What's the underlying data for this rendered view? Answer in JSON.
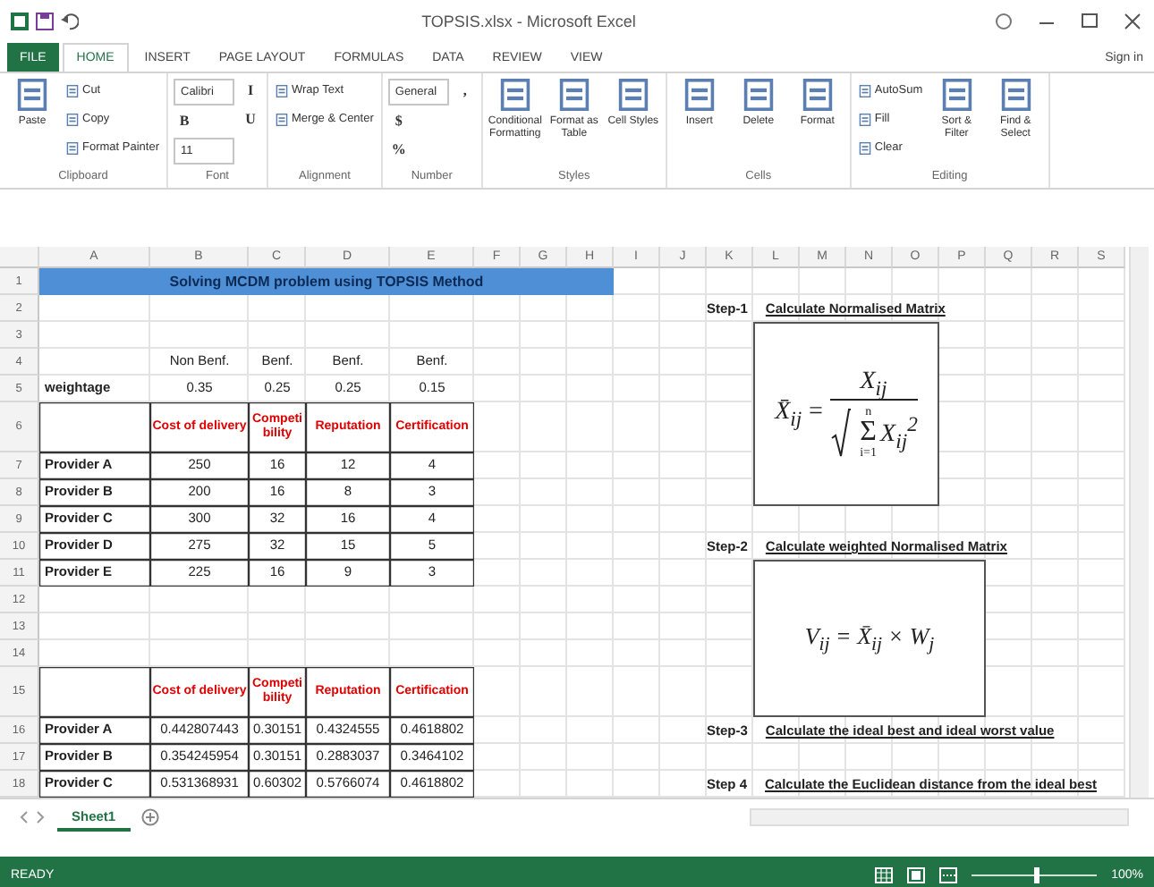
{
  "window": {
    "title": "TOPSIS.xlsx - Microsoft Excel"
  },
  "ribbon_tabs": [
    {
      "label": "FILE",
      "kind": "file",
      "selected": false
    },
    {
      "label": "HOME",
      "kind": "tab",
      "selected": true
    },
    {
      "label": "INSERT",
      "kind": "tab",
      "selected": false
    },
    {
      "label": "PAGE LAYOUT",
      "kind": "tab",
      "selected": false
    },
    {
      "label": "FORMULAS",
      "kind": "tab",
      "selected": false
    },
    {
      "label": "DATA",
      "kind": "tab",
      "selected": false
    },
    {
      "label": "REVIEW",
      "kind": "tab",
      "selected": false
    },
    {
      "label": "VIEW",
      "kind": "tab",
      "selected": false
    }
  ],
  "sign_in": "Sign in",
  "ribbon_groups": [
    {
      "name": "Clipboard",
      "controls": [
        {
          "kind": "large",
          "label": "Paste"
        },
        {
          "kind": "small",
          "label": "Cut"
        },
        {
          "kind": "small",
          "label": "Copy"
        },
        {
          "kind": "small",
          "label": "Format Painter"
        }
      ]
    },
    {
      "name": "Font",
      "controls": [
        {
          "kind": "combo",
          "label": "Calibri"
        },
        {
          "kind": "glyph",
          "label": "B"
        },
        {
          "kind": "combo",
          "label": "11"
        },
        {
          "kind": "glyph",
          "label": "I"
        },
        {
          "kind": "glyph",
          "label": "U"
        }
      ]
    },
    {
      "name": "Alignment",
      "controls": [
        {
          "kind": "small",
          "label": "Wrap Text"
        },
        {
          "kind": "small",
          "label": "Merge & Center"
        }
      ]
    },
    {
      "name": "Number",
      "controls": [
        {
          "kind": "combo",
          "label": "General"
        },
        {
          "kind": "glyph",
          "label": "$"
        },
        {
          "kind": "glyph",
          "label": "%"
        },
        {
          "kind": "glyph",
          "label": ","
        }
      ]
    },
    {
      "name": "Styles",
      "controls": [
        {
          "kind": "large",
          "label": "Conditional Formatting"
        },
        {
          "kind": "large",
          "label": "Format as Table"
        },
        {
          "kind": "large",
          "label": "Cell Styles"
        }
      ]
    },
    {
      "name": "Cells",
      "controls": [
        {
          "kind": "large",
          "label": "Insert"
        },
        {
          "kind": "large",
          "label": "Delete"
        },
        {
          "kind": "large",
          "label": "Format"
        }
      ]
    },
    {
      "name": "Editing",
      "controls": [
        {
          "kind": "small",
          "label": "AutoSum"
        },
        {
          "kind": "small",
          "label": "Fill"
        },
        {
          "kind": "small",
          "label": "Clear"
        },
        {
          "kind": "large",
          "label": "Sort & Filter"
        },
        {
          "kind": "large",
          "label": "Find & Select"
        }
      ]
    }
  ],
  "sheet": {
    "columns": [
      "A",
      "B",
      "C",
      "D",
      "E",
      "F",
      "G",
      "H",
      "I",
      "J",
      "K",
      "L",
      "M",
      "N",
      "O",
      "P",
      "Q",
      "R",
      "S"
    ],
    "rows": [
      "1",
      "2",
      "3",
      "4",
      "5",
      "6",
      "7",
      "8",
      "9",
      "10",
      "11",
      "12",
      "13",
      "14",
      "15",
      "16",
      "17",
      "18"
    ],
    "title": "Solving MCDM problem using TOPSIS Method",
    "criteria_types": [
      "Non Benf.",
      "Benf.",
      "Benf.",
      "Benf."
    ],
    "weightage": {
      "label": "weightage",
      "values": [
        "0.35",
        "0.25",
        "0.25",
        "0.15"
      ]
    },
    "table_1": {
      "headers": [
        "Cost of delivery",
        "Competibility",
        "Reputation",
        "Certification"
      ],
      "rows": [
        {
          "name": "Provider A",
          "values": [
            "250",
            "16",
            "12",
            "4"
          ]
        },
        {
          "name": "Provider B",
          "values": [
            "200",
            "16",
            "8",
            "3"
          ]
        },
        {
          "name": "Provider C",
          "values": [
            "300",
            "32",
            "16",
            "4"
          ]
        },
        {
          "name": "Provider D",
          "values": [
            "275",
            "32",
            "15",
            "5"
          ]
        },
        {
          "name": "Provider E",
          "values": [
            "225",
            "16",
            "9",
            "3"
          ]
        }
      ]
    },
    "table_2": {
      "headers": [
        "Cost of delivery",
        "Competibility",
        "Reputation",
        "Certification"
      ],
      "rows": [
        {
          "name": "Provider A",
          "values": [
            "0.442807443",
            "0.30151",
            "0.4324555",
            "0.4618802"
          ]
        },
        {
          "name": "Provider B",
          "values": [
            "0.354245954",
            "0.30151",
            "0.2883037",
            "0.3464102"
          ]
        },
        {
          "name": "Provider C",
          "values": [
            "0.531368931",
            "0.60302",
            "0.5766074",
            "0.4618802"
          ]
        }
      ]
    },
    "steps": [
      {
        "label": "Step-1",
        "text": "Calculate Normalised Matrix"
      },
      {
        "label": "Step-2",
        "text": "Calculate weighted Normalised Matrix"
      },
      {
        "label": "Step-3",
        "text": "Calculate the ideal best and ideal worst value"
      },
      {
        "label": "Step 4",
        "text": "Calculate the Euclidean distance from the ideal best"
      }
    ],
    "formula_1": {
      "lhs": "X̄$_{ij}$",
      "eq": "=",
      "numerator": "X$_{ij}$",
      "sum_top": "n",
      "sum_sign": "Σ",
      "sum_bottom": "i=1",
      "radicand": "X$_{ij}$$^{2}$"
    },
    "formula_2": "V$_{ij}$ = X̄$_{ij}$ × W$_{j}$"
  },
  "sheet_tabs": [
    {
      "label": "Sheet1",
      "selected": true
    }
  ],
  "status": {
    "label": "READY",
    "zoom": "100%",
    "zoom_slider": {
      "level": 0.5
    }
  }
}
